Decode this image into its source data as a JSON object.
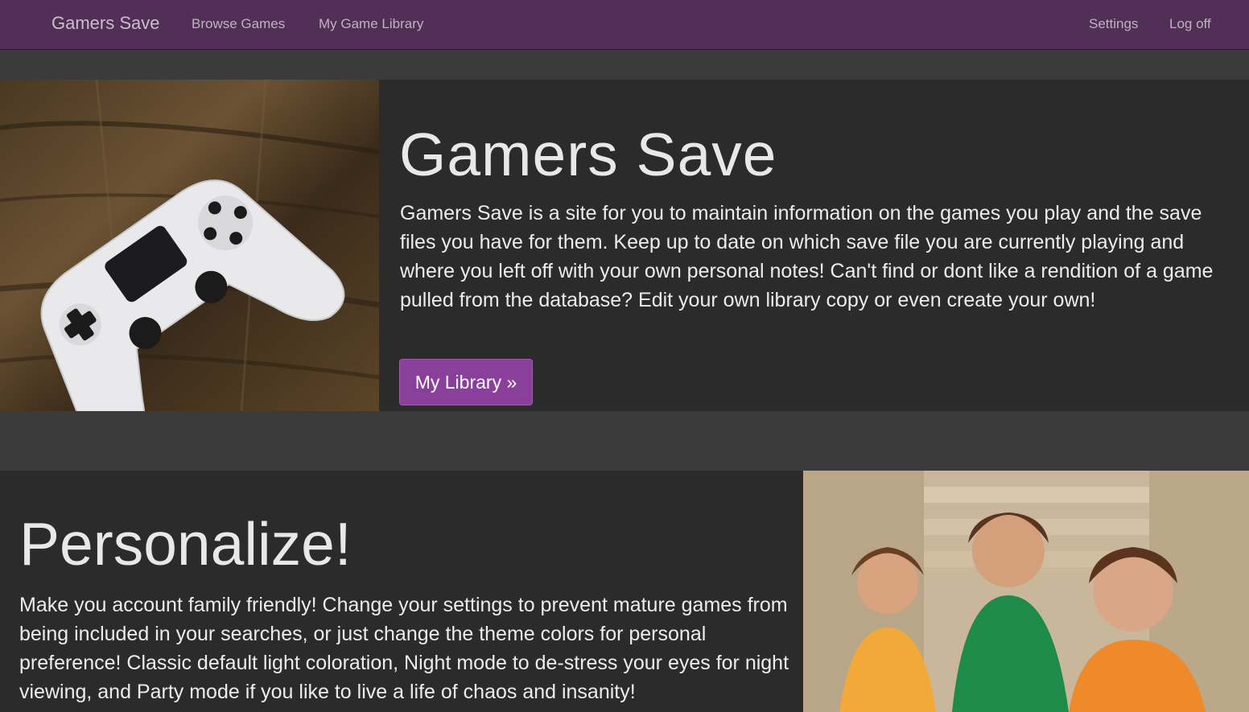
{
  "navbar": {
    "brand": "Gamers Save",
    "links": [
      "Browse Games",
      "My Game Library"
    ],
    "right_links": [
      "Settings",
      "Log off"
    ],
    "background": "#522f57"
  },
  "hero": {
    "image_alt": "Photo of a white game controller on a wooden table",
    "title": "Gamers Save",
    "description": "Gamers Save is a site for you to maintain information on the games you play and the save files you have for them. Keep up to date on which save file you are currently playing and where you left off with your own personal notes! Can't find or dont like a rendition of a game pulled from the database? Edit your own library copy or even create your own!",
    "button_label": "My Library »",
    "button_color": "#8a3f9b"
  },
  "feature": {
    "title": "Personalize!",
    "description": "Make you account family friendly! Change your settings to prevent mature games from being included in your searches, or just change the theme colors for personal preference! Classic default light coloration, Night mode to de-stress your eyes for night viewing, and Party mode if you like to live a life of chaos and insanity!",
    "image_alt": "Photo of three smiling children giving a thumbs up on stone steps"
  }
}
